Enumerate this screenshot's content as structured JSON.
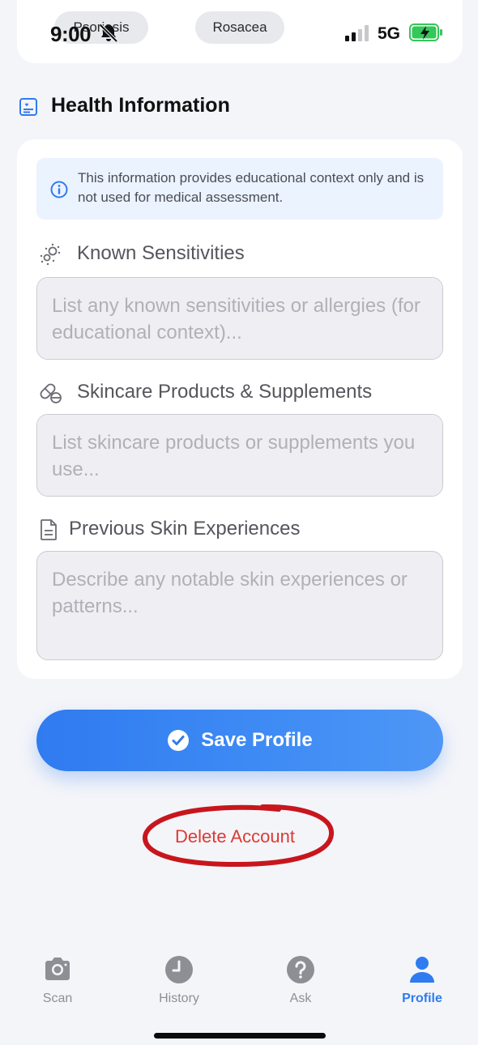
{
  "status_bar": {
    "time": "9:00",
    "network": "5G"
  },
  "conditions": {
    "chips": [
      "Psoriasis",
      "Rosacea"
    ]
  },
  "health": {
    "title": "Health Information",
    "notice": "This information provides educational context only and is not used for medical assessment.",
    "fields": [
      {
        "label": "Known Sensitivities",
        "placeholder": "List any known sensitivities or allergies (for educational context)..."
      },
      {
        "label": "Skincare Products & Supplements",
        "placeholder": "List skincare products or supplements you use..."
      },
      {
        "label": "Previous Skin Experiences",
        "placeholder": "Describe any notable skin experiences or patterns..."
      }
    ]
  },
  "actions": {
    "save_label": "Save Profile",
    "delete_label": "Delete Account"
  },
  "tabs": [
    {
      "label": "Scan",
      "icon": "camera-icon"
    },
    {
      "label": "History",
      "icon": "clock-icon"
    },
    {
      "label": "Ask",
      "icon": "question-icon"
    },
    {
      "label": "Profile",
      "icon": "person-icon"
    }
  ],
  "colors": {
    "accent": "#2f7bf0",
    "danger": "#dc3a34",
    "annotation": "#c8161d"
  }
}
